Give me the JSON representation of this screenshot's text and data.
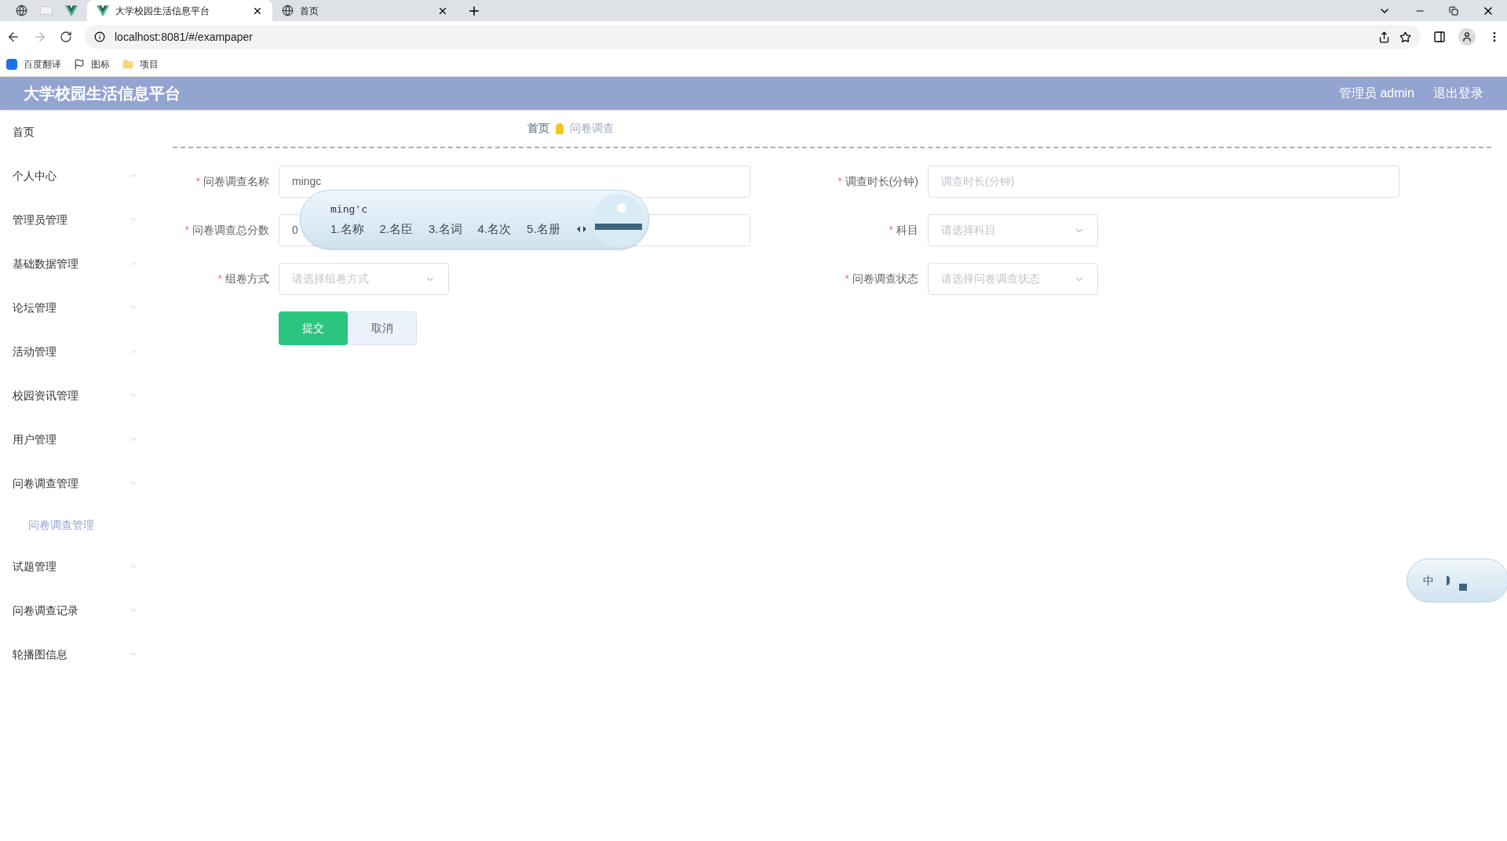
{
  "browser": {
    "tabs": [
      {
        "label": "大学校园生活信息平台",
        "selected": true
      },
      {
        "label": "首页",
        "selected": false
      }
    ],
    "address": "localhost:8081/#/exampaper",
    "bookmarks": [
      "百度翻译",
      "图标",
      "项目"
    ]
  },
  "header": {
    "title": "大学校园生活信息平台",
    "user": "管理员 admin",
    "logout": "退出登录"
  },
  "sidebar": {
    "items": [
      {
        "label": "首页",
        "kind": "link"
      },
      {
        "label": "个人中心",
        "kind": "submenu",
        "expanded": false
      },
      {
        "label": "管理员管理",
        "kind": "submenu",
        "expanded": false
      },
      {
        "label": "基础数据管理",
        "kind": "submenu",
        "expanded": false
      },
      {
        "label": "论坛管理",
        "kind": "submenu",
        "expanded": false
      },
      {
        "label": "活动管理",
        "kind": "submenu",
        "expanded": false
      },
      {
        "label": "校园资讯管理",
        "kind": "submenu",
        "expanded": false
      },
      {
        "label": "用户管理",
        "kind": "submenu",
        "expanded": false
      },
      {
        "label": "问卷调查管理",
        "kind": "submenu",
        "expanded": true,
        "children": [
          {
            "label": "问卷调查管理",
            "selected": true
          }
        ]
      },
      {
        "label": "试题管理",
        "kind": "submenu",
        "expanded": false
      },
      {
        "label": "问卷调查记录",
        "kind": "submenu",
        "expanded": false
      },
      {
        "label": "轮播图信息",
        "kind": "submenu",
        "expanded": false
      }
    ]
  },
  "breadcrumb": [
    "首页",
    "问卷调查"
  ],
  "form": {
    "rows": [
      [
        {
          "label": "问卷调查名称",
          "marker": "*",
          "kind": "input",
          "value": "mingc"
        },
        {
          "label": "调查时长(分钟)",
          "marker": "*",
          "kind": "input",
          "placeholder": "调查时长(分钟)"
        }
      ],
      [
        {
          "label": "问卷调查总分数",
          "marker": "*",
          "kind": "input",
          "value": "0"
        },
        {
          "label": "科目",
          "marker": "*",
          "kind": "select",
          "placeholder": "请选择科目"
        }
      ],
      [
        {
          "label": "组卷方式",
          "marker": "*",
          "kind": "select",
          "placeholder": "请选择组卷方式"
        },
        {
          "label": "问卷调查状态",
          "marker": "*",
          "kind": "select",
          "placeholder": "请选择问卷调查状态"
        }
      ]
    ],
    "buttons": [
      {
        "label": "提交",
        "kind": "primary"
      },
      {
        "label": "取消",
        "kind": "default"
      }
    ]
  },
  "ime": {
    "composition": "ming'c",
    "candidates": [
      "1.名称",
      "2.名臣",
      "3.名词",
      "4.名次",
      "5.名册"
    ],
    "mode": "中"
  }
}
